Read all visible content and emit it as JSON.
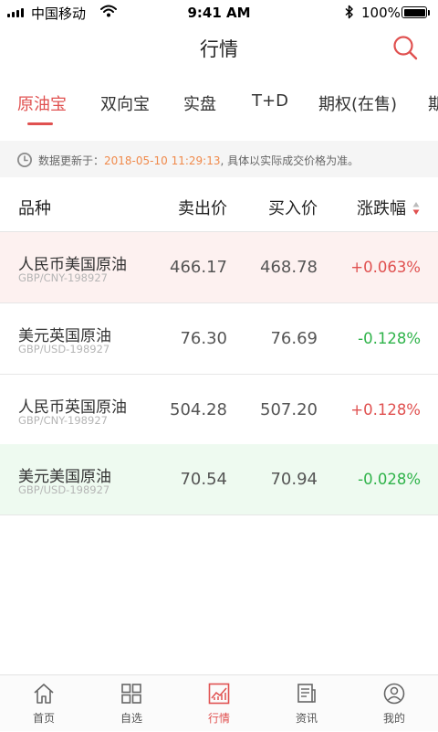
{
  "status_bar": {
    "carrier": "中国移动",
    "time": "9:41 AM",
    "battery": "100%"
  },
  "header": {
    "title": "行情",
    "search_icon": "search-icon"
  },
  "tabs": [
    {
      "label": "原油宝",
      "active": true
    },
    {
      "label": "双向宝",
      "active": false
    },
    {
      "label": "实盘",
      "active": false
    },
    {
      "label": "T+D",
      "active": false
    },
    {
      "label": "期权(在售)",
      "active": false
    },
    {
      "label": "期",
      "active": false
    }
  ],
  "notice": {
    "icon": "clock-icon",
    "prefix": "数据更新于：",
    "time": "2018-05-10 11:29:13",
    "suffix": ", 具体以实际成交价格为准。"
  },
  "table": {
    "headers": {
      "name": "品种",
      "sell": "卖出价",
      "buy": "买入价",
      "change": "涨跌幅"
    },
    "rows": [
      {
        "name": "人民币美国原油",
        "code": "GBP/CNY-198927",
        "sell": "466.17",
        "buy": "468.78",
        "change": "+0.063%",
        "direction": "up",
        "highlight": "up"
      },
      {
        "name": "美元英国原油",
        "code": "GBP/USD-198927",
        "sell": "76.30",
        "buy": "76.69",
        "change": "-0.128%",
        "direction": "down",
        "highlight": "none"
      },
      {
        "name": "人民币英国原油",
        "code": "GBP/CNY-198927",
        "sell": "504.28",
        "buy": "507.20",
        "change": "+0.128%",
        "direction": "up",
        "highlight": "none"
      },
      {
        "name": "美元美国原油",
        "code": "GBP/USD-198927",
        "sell": "70.54",
        "buy": "70.94",
        "change": "-0.028%",
        "direction": "down",
        "highlight": "down"
      }
    ]
  },
  "bottom_nav": [
    {
      "label": "首页",
      "icon": "home-icon",
      "active": false
    },
    {
      "label": "自选",
      "icon": "grid-icon",
      "active": false
    },
    {
      "label": "行情",
      "icon": "chart-icon",
      "active": true
    },
    {
      "label": "资讯",
      "icon": "news-icon",
      "active": false
    },
    {
      "label": "我的",
      "icon": "user-icon",
      "active": false
    }
  ],
  "colors": {
    "accent": "#e05150",
    "up": "#e05150",
    "down": "#2fb34a",
    "up_row_bg": "#fdf1f0",
    "down_row_bg": "#eefaf0",
    "notice_time": "#f08a4b"
  }
}
